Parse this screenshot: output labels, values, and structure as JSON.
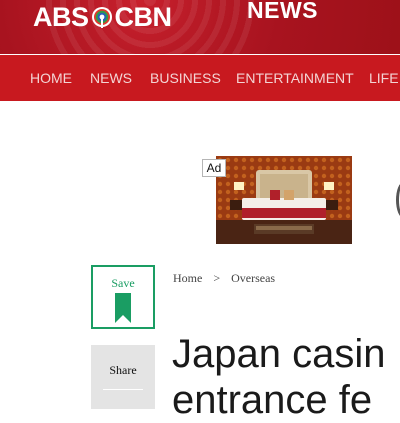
{
  "header": {
    "logo_left": "ABS",
    "logo_right": "CBN",
    "section": "NEWS"
  },
  "nav": {
    "items": [
      "HOME",
      "NEWS",
      "BUSINESS",
      "ENTERTAINMENT",
      "LIFE"
    ]
  },
  "ad": {
    "label": "Ad",
    "image_icon": "hotel-room-image"
  },
  "actions": {
    "save_label": "Save",
    "share_label": "Share",
    "accent_color": "#1a9d63"
  },
  "breadcrumb": {
    "home": "Home",
    "separator": ">",
    "section": "Overseas"
  },
  "article": {
    "headline_line1": "Japan casin",
    "headline_line2": "entrance fe"
  },
  "colors": {
    "header_red": "#b81a26",
    "nav_red": "#c8191f"
  }
}
